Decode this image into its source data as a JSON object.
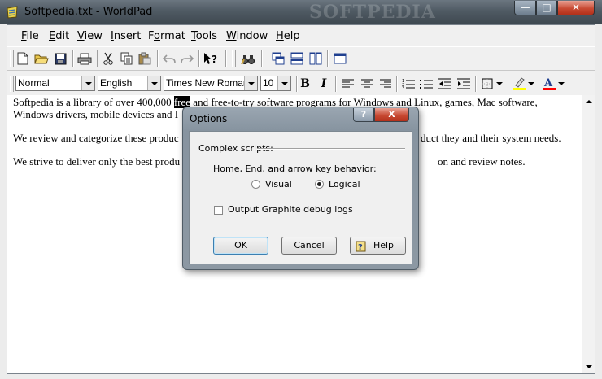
{
  "window": {
    "title": "Softpedia.txt - WorldPad",
    "watermark": "SOFTPEDIA"
  },
  "menu": [
    "File",
    "Edit",
    "View",
    "Insert",
    "Format",
    "Tools",
    "Window",
    "Help"
  ],
  "menu_mnemonics": [
    "F",
    "E",
    "V",
    "I",
    "o",
    "T",
    "W",
    "H"
  ],
  "format_bar": {
    "style": "Normal",
    "language": "English",
    "font": "Times New Roman",
    "size": "10"
  },
  "document": {
    "p1_before": "Softpedia is a library of over 400,000 ",
    "p1_selected": "free",
    "p1_after": " and free-to-try software programs for Windows and Linux, games, Mac software, Windows drivers, mobile devices and I",
    "p2": "We review and categorize these produc",
    "p2_right": "duct they and their system needs.",
    "p3": "We strive to deliver only the best produ",
    "p3_right": "on and review notes."
  },
  "dialog": {
    "title": "Options",
    "help_glyph": "?",
    "close_glyph": "X",
    "group_label": "Complex scripts:",
    "key_behavior_label": "Home, End, and arrow key behavior:",
    "radio_visual": "Visual",
    "radio_logical": "Logical",
    "radio_selected": "Logical",
    "checkbox_label": "Output Graphite debug logs",
    "checkbox_checked": false,
    "ok": "OK",
    "cancel": "Cancel",
    "help": "Help"
  },
  "colors": {
    "highlight": "#ffff00",
    "font_color": "#ff0000",
    "selection": "#000000"
  }
}
